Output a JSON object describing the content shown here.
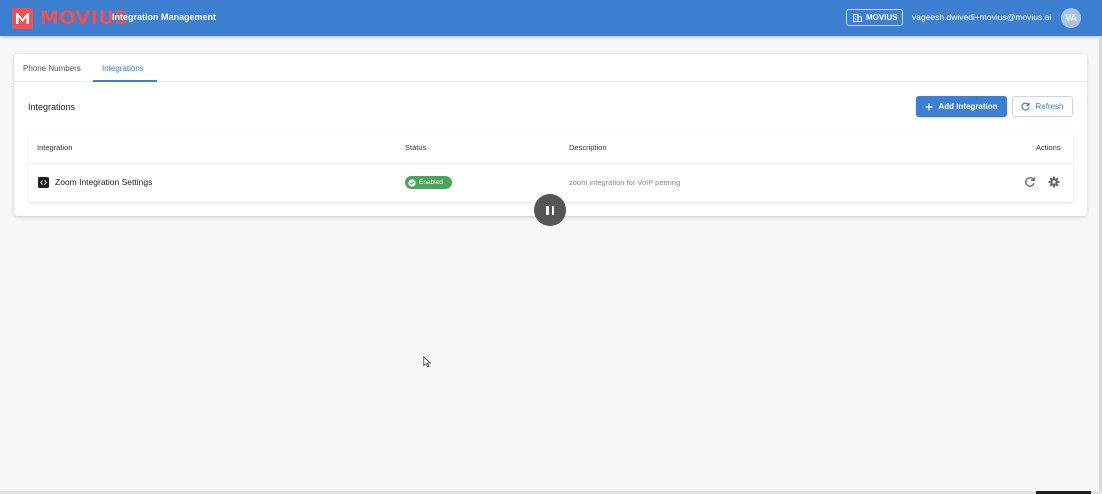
{
  "header": {
    "brand": "MOVIUS",
    "title": "Integration Management",
    "org_label": "MOVIUS",
    "user_email": "vageesh.dwivedi+movius@movius.ai",
    "avatar_initials": "VA",
    "accent_color": "#3d7fd1",
    "brand_color": "#f0504f"
  },
  "tabs": [
    {
      "label": "Phone Numbers",
      "active": false
    },
    {
      "label": "Integrations",
      "active": true
    }
  ],
  "section": {
    "title": "Integrations",
    "add_button": "Add Integration",
    "refresh_button": "Refresh"
  },
  "table": {
    "columns": [
      "Integration",
      "Status",
      "Description",
      "Actions"
    ],
    "rows": [
      {
        "integration": "Zoom Integration Settings",
        "status": "Enabled",
        "description": "zoom integration for VoIP peering",
        "actions": [
          "refresh-icon",
          "gear-icon"
        ]
      }
    ]
  },
  "icons": {
    "brand": "movius-m-icon",
    "org": "building-icon",
    "add": "plus-icon",
    "refresh": "refresh-icon",
    "row": "code-icon",
    "status": "check-circle-icon",
    "settings": "gear-icon",
    "player": "pause-icon"
  },
  "colors": {
    "enabled": "#4aa55a"
  }
}
